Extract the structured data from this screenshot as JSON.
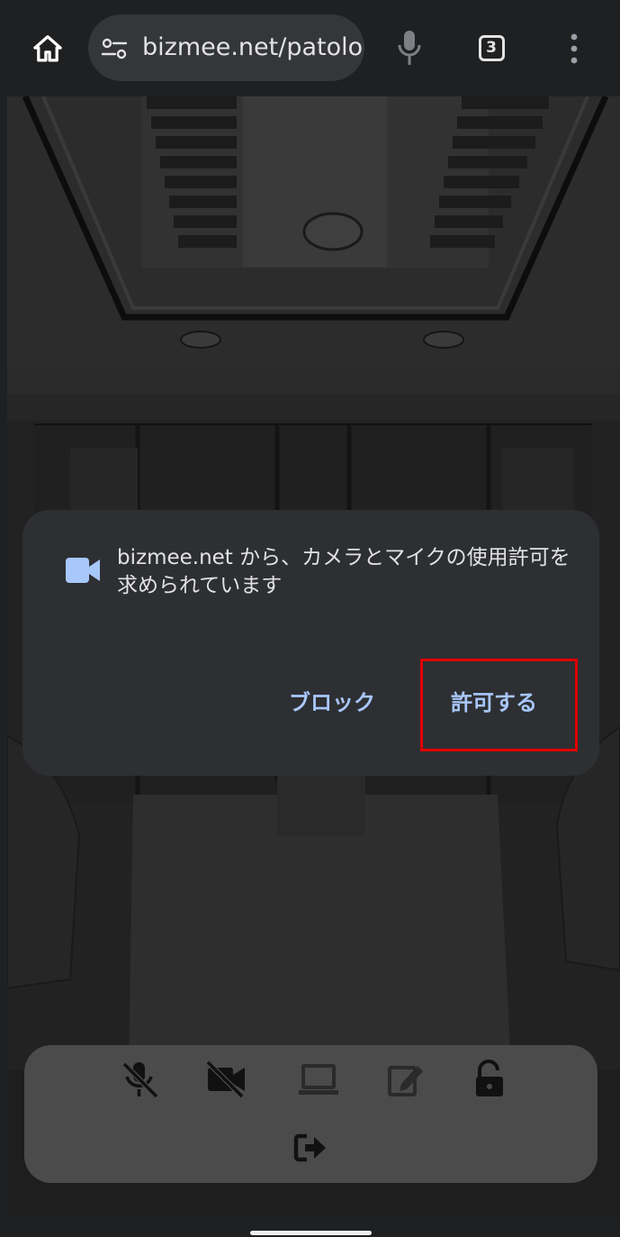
{
  "browser": {
    "url": "bizmee.net/patolo",
    "tab_count": "3"
  },
  "dialog": {
    "message": "bizmee.net から、カメラとマイクの使用許可を求められています",
    "block_label": "ブロック",
    "allow_label": "許可する",
    "icon": "videocam-icon",
    "highlight_color": "#e00000"
  },
  "controls": {
    "icons": [
      "mic-off-icon",
      "videocam-off-icon",
      "laptop-icon",
      "edit-icon",
      "lock-open-icon",
      "exit-icon"
    ]
  },
  "colors": {
    "dialog_bg": "#2d2f33",
    "accent": "#a8c7fa",
    "control_bar_bg": "#4b4b4b"
  }
}
